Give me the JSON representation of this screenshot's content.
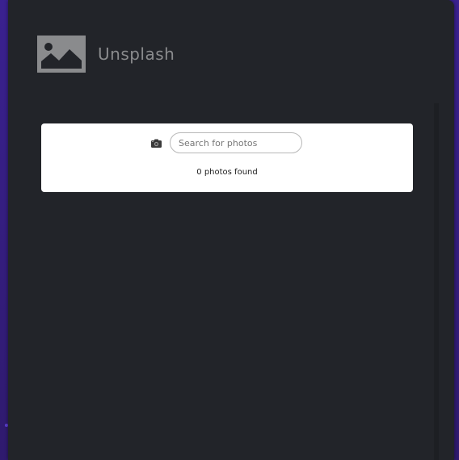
{
  "app": {
    "title": "Unsplash",
    "logo_icon": "image-icon"
  },
  "search": {
    "icon": "camera-icon",
    "placeholder": "Search for photos",
    "value": ""
  },
  "results": {
    "count_text": "0 photos found"
  },
  "colors": {
    "window_bg": "#222429",
    "card_bg": "#ffffff",
    "backdrop": "#3a2190",
    "title": "#8a8b8d"
  }
}
